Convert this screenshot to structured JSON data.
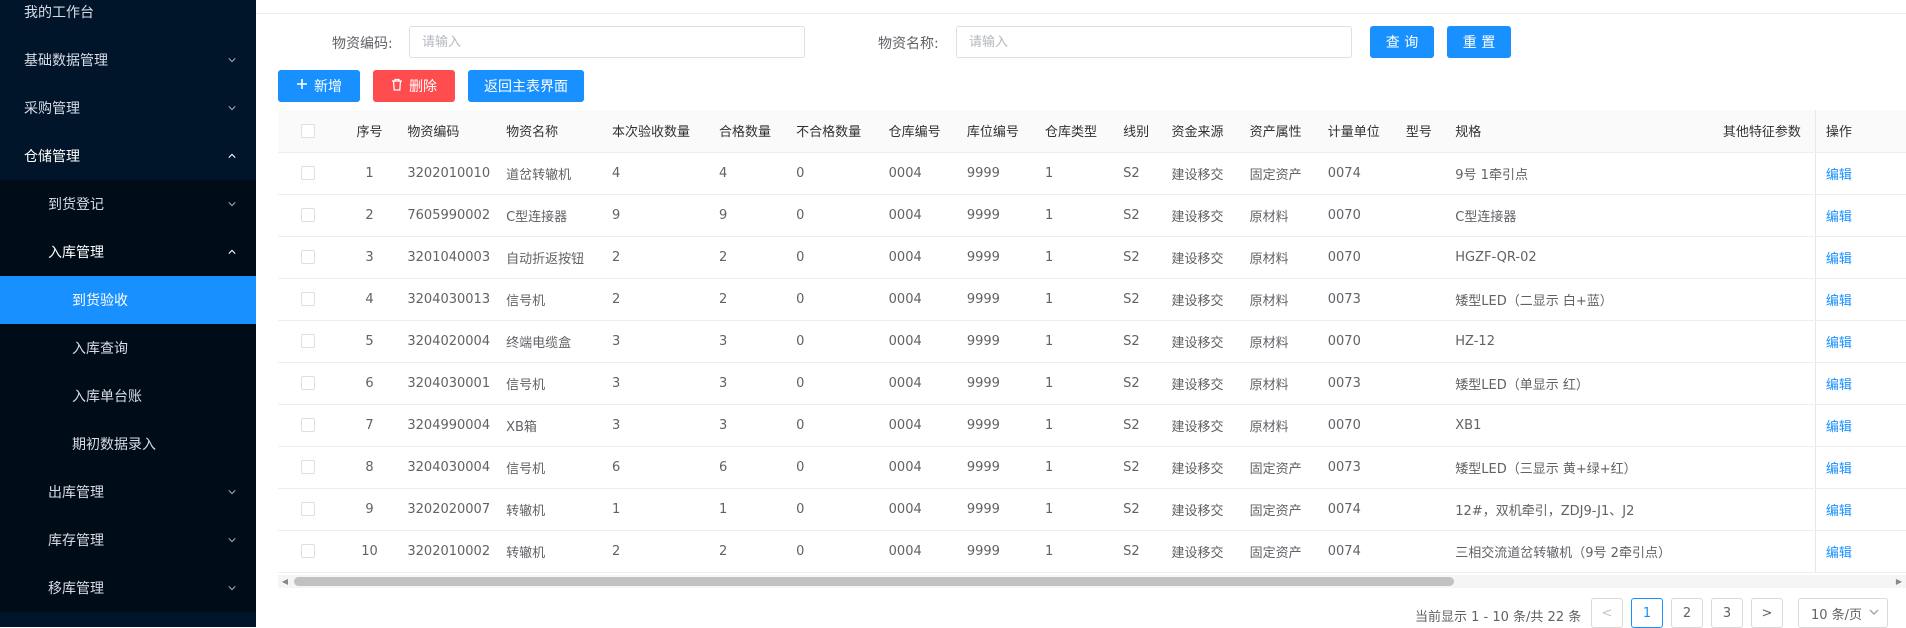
{
  "sidebar": {
    "items": [
      {
        "label": "我的工作台",
        "chevron": ""
      },
      {
        "label": "基础数据管理",
        "chevron": "⌄"
      },
      {
        "label": "采购管理",
        "chevron": "⌄"
      },
      {
        "label": "仓储管理",
        "chevron": "⌃"
      },
      {
        "label": "到货登记",
        "chevron": "⌄"
      },
      {
        "label": "入库管理",
        "chevron": "⌃"
      },
      {
        "label": "到货验收",
        "chevron": ""
      },
      {
        "label": "入库查询",
        "chevron": ""
      },
      {
        "label": "入库单台账",
        "chevron": ""
      },
      {
        "label": "期初数据录入",
        "chevron": ""
      },
      {
        "label": "出库管理",
        "chevron": "⌄"
      },
      {
        "label": "库存管理",
        "chevron": "⌄"
      },
      {
        "label": "移库管理",
        "chevron": "⌄"
      }
    ]
  },
  "search": {
    "code_label": "物资编码:",
    "code_placeholder": "请输入",
    "name_label": "物资名称:",
    "name_placeholder": "请输入",
    "query_label": "查 询",
    "reset_label": "重 置"
  },
  "toolbar": {
    "add_label": "新增",
    "delete_label": "删除",
    "back_label": "返回主表界面"
  },
  "table": {
    "headers": [
      "序号",
      "物资编码",
      "物资名称",
      "本次验收数量",
      "合格数量",
      "不合格数量",
      "仓库编号",
      "库位编号",
      "仓库类型",
      "线别",
      "资金来源",
      "资产属性",
      "计量单位",
      "型号",
      "规格",
      "其他特征参数",
      "操作"
    ],
    "rows": [
      [
        "1",
        "3202010010",
        "道岔转辙机",
        "4",
        "4",
        "0",
        "0004",
        "9999",
        "1",
        "S2",
        "建设移交",
        "固定资产",
        "0074",
        "",
        "9号 1牵引点",
        "",
        "编辑"
      ],
      [
        "2",
        "7605990002",
        "C型连接器",
        "9",
        "9",
        "0",
        "0004",
        "9999",
        "1",
        "S2",
        "建设移交",
        "原材料",
        "0070",
        "",
        "C型连接器",
        "",
        "编辑"
      ],
      [
        "3",
        "3201040003",
        "自动折返按钮",
        "2",
        "2",
        "0",
        "0004",
        "9999",
        "1",
        "S2",
        "建设移交",
        "原材料",
        "0070",
        "",
        "HGZF-QR-02",
        "",
        "编辑"
      ],
      [
        "4",
        "3204030013",
        "信号机",
        "2",
        "2",
        "0",
        "0004",
        "9999",
        "1",
        "S2",
        "建设移交",
        "原材料",
        "0073",
        "",
        "矮型LED（二显示 白+蓝）",
        "",
        "编辑"
      ],
      [
        "5",
        "3204020004",
        "终端电缆盒",
        "3",
        "3",
        "0",
        "0004",
        "9999",
        "1",
        "S2",
        "建设移交",
        "原材料",
        "0070",
        "",
        "HZ-12",
        "",
        "编辑"
      ],
      [
        "6",
        "3204030001",
        "信号机",
        "3",
        "3",
        "0",
        "0004",
        "9999",
        "1",
        "S2",
        "建设移交",
        "原材料",
        "0073",
        "",
        "矮型LED（单显示 红）",
        "",
        "编辑"
      ],
      [
        "7",
        "3204990004",
        "XB箱",
        "3",
        "3",
        "0",
        "0004",
        "9999",
        "1",
        "S2",
        "建设移交",
        "原材料",
        "0070",
        "",
        "XB1",
        "",
        "编辑"
      ],
      [
        "8",
        "3204030004",
        "信号机",
        "6",
        "6",
        "0",
        "0004",
        "9999",
        "1",
        "S2",
        "建设移交",
        "固定资产",
        "0073",
        "",
        "矮型LED（三显示 黄+绿+红）",
        "",
        "编辑"
      ],
      [
        "9",
        "3202020007",
        "转辙机",
        "1",
        "1",
        "0",
        "0004",
        "9999",
        "1",
        "S2",
        "建设移交",
        "固定资产",
        "0074",
        "",
        "12#，双机牵引，ZDJ9-J1、J2",
        "",
        "编辑"
      ],
      [
        "10",
        "3202010002",
        "转辙机",
        "2",
        "2",
        "0",
        "0004",
        "9999",
        "1",
        "S2",
        "建设移交",
        "固定资产",
        "0074",
        "",
        "三相交流道岔转辙机（9号 2牵引点）",
        "",
        "编辑"
      ]
    ]
  },
  "pagination": {
    "info": "当前显示 1 - 10 条/共 22 条",
    "prev": "<",
    "pages": [
      "1",
      "2",
      "3"
    ],
    "next": ">",
    "page_size": "10 条/页",
    "current": "1"
  },
  "colors": {
    "sidebar_bg": "#001529",
    "sidebar_sub_bg": "#000c17",
    "accent": "#1890ff",
    "danger": "#ff4d4f"
  }
}
